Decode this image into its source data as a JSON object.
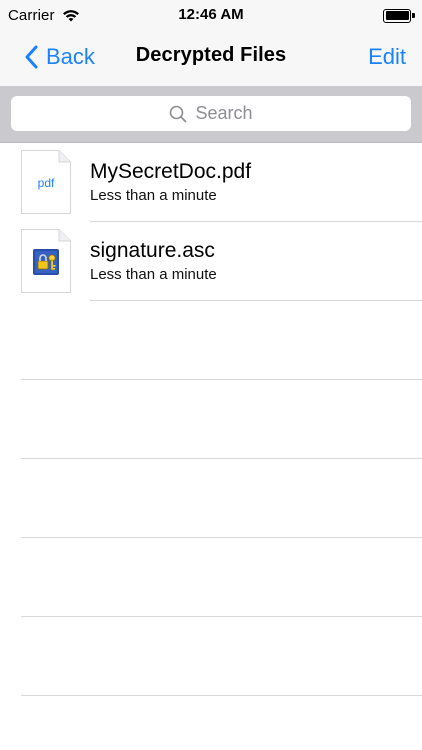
{
  "status_bar": {
    "carrier": "Carrier",
    "time": "12:46 AM",
    "wifi_icon": "wifi-icon",
    "battery_level": 1.0
  },
  "nav_bar": {
    "back_label": "Back",
    "title": "Decrypted Files",
    "edit_label": "Edit",
    "accent_color": "#1a82fb"
  },
  "search": {
    "placeholder": "Search"
  },
  "files": [
    {
      "name": "MySecretDoc.pdf",
      "subtitle": "Less than a minute",
      "icon": "pdf-file-icon",
      "icon_label": "pdf"
    },
    {
      "name": "signature.asc",
      "subtitle": "Less than a minute",
      "icon": "key-file-icon"
    }
  ]
}
